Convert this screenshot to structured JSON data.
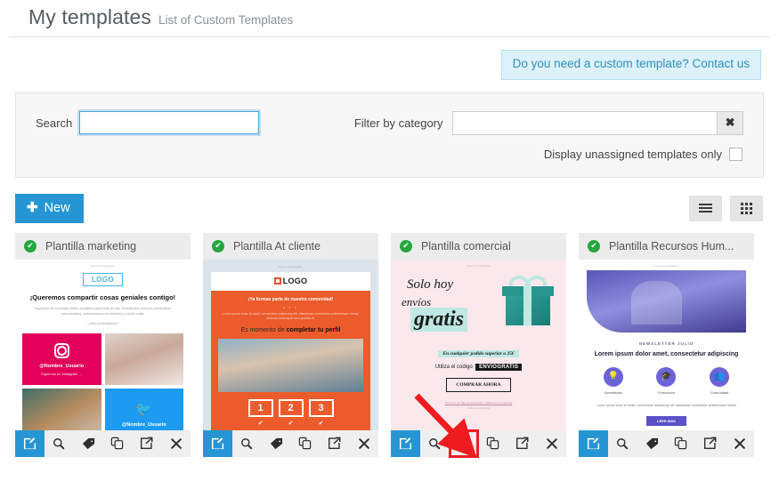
{
  "header": {
    "title": "My templates",
    "subtitle": "List of Custom Templates"
  },
  "banner": {
    "text": "Do you need a custom template? Contact us"
  },
  "filters": {
    "search_label": "Search",
    "search_value": "",
    "search_placeholder": "",
    "category_label": "Filter by category",
    "category_value": "",
    "category_placeholder": "",
    "clear_icon": "✖",
    "unassigned_label": "Display unassigned templates only",
    "unassigned_checked": false
  },
  "toolbar": {
    "new_label": "New",
    "new_plus": "✚",
    "new_color": "#2596d3",
    "view_list_icon": "list-view-icon",
    "view_grid_icon": "grid-view-icon",
    "active_view": "grid"
  },
  "card_actions": {
    "edit": "Edit",
    "preview": "Preview",
    "tag": "Categories",
    "duplicate": "Duplicate",
    "export": "Export",
    "delete": "Delete"
  },
  "annotation": {
    "arrow_color": "#ee1c21",
    "highlight_color": "#ee1c21",
    "highlighted_card_index": 2,
    "highlighted_action": "tag"
  },
  "cards": [
    {
      "title": "Plantilla marketing",
      "status_icon": "check-circle-icon",
      "status_color": "#25a63f",
      "thumb": {
        "preheader": "Ver en el navegador",
        "logo": "LOGO",
        "heading": "¡Queremos compartir cosas geniales contigo!",
        "body": "Síguenos en nuestras redes sociales para estar al día: novedades, nuevos contenidos, curiosidades, promociones exclusivas y mucho más.",
        "body2": "¿Nos conectamos?",
        "instagram_user": "@Nombre_Usuario",
        "instagram_cta": "Síguenos en Instagram →",
        "twitter_user": "@Nombre_Usuario"
      }
    },
    {
      "title": "Plantilla At cliente",
      "status_icon": "check-circle-icon",
      "status_color": "#25a63f",
      "thumb": {
        "preheader": "Ver en el navegador",
        "logo": "LOGO",
        "heading": "¡Ya formas parte de nuestra comunidad!",
        "dots": "• • •",
        "body": "Lorem ipsum dolor sit amet, consectetur adipiscing elit. Maecenas consectetur pellentesque metus, vehicula consequat arcu gravida et.",
        "subheading_plain": "Es momento de ",
        "subheading_bold": "completar tu perfil",
        "steps": [
          "1",
          "2",
          "3"
        ]
      }
    },
    {
      "title": "Plantilla comercial",
      "status_icon": "check-circle-icon",
      "status_color": "#25a63f",
      "thumb": {
        "preheader": "Ver en el navegador",
        "line1": "Solo hoy",
        "line2": "envíos",
        "line3": "gratis",
        "condition": "En cualquier pedido superior a 25€",
        "code_label": "Utiliza el código:",
        "code": "ENVIOGRATIS",
        "cta": "COMPRAR AHORA",
        "footer1": "Términos de baja de suscripción | Añádenos a tu agenda",
        "footer2": "Política de privacidad"
      }
    },
    {
      "title": "Plantilla Recursos Hum...",
      "status_icon": "check-circle-icon",
      "status_color": "#25a63f",
      "thumb": {
        "preheader": "Ver en el navegador",
        "kicker": "NEWSLETTER JULIO",
        "heading": "Lorem ipsum dolor amet, consectetur adipiscing",
        "features": [
          "Novedades",
          "Formación",
          "Comunidad"
        ],
        "body": "Lorem ipsum dolor sit amet, consectetur adipiscing elit. Maecenas consectetur pellentesque metus",
        "cta": "LEER MÁS"
      }
    }
  ]
}
